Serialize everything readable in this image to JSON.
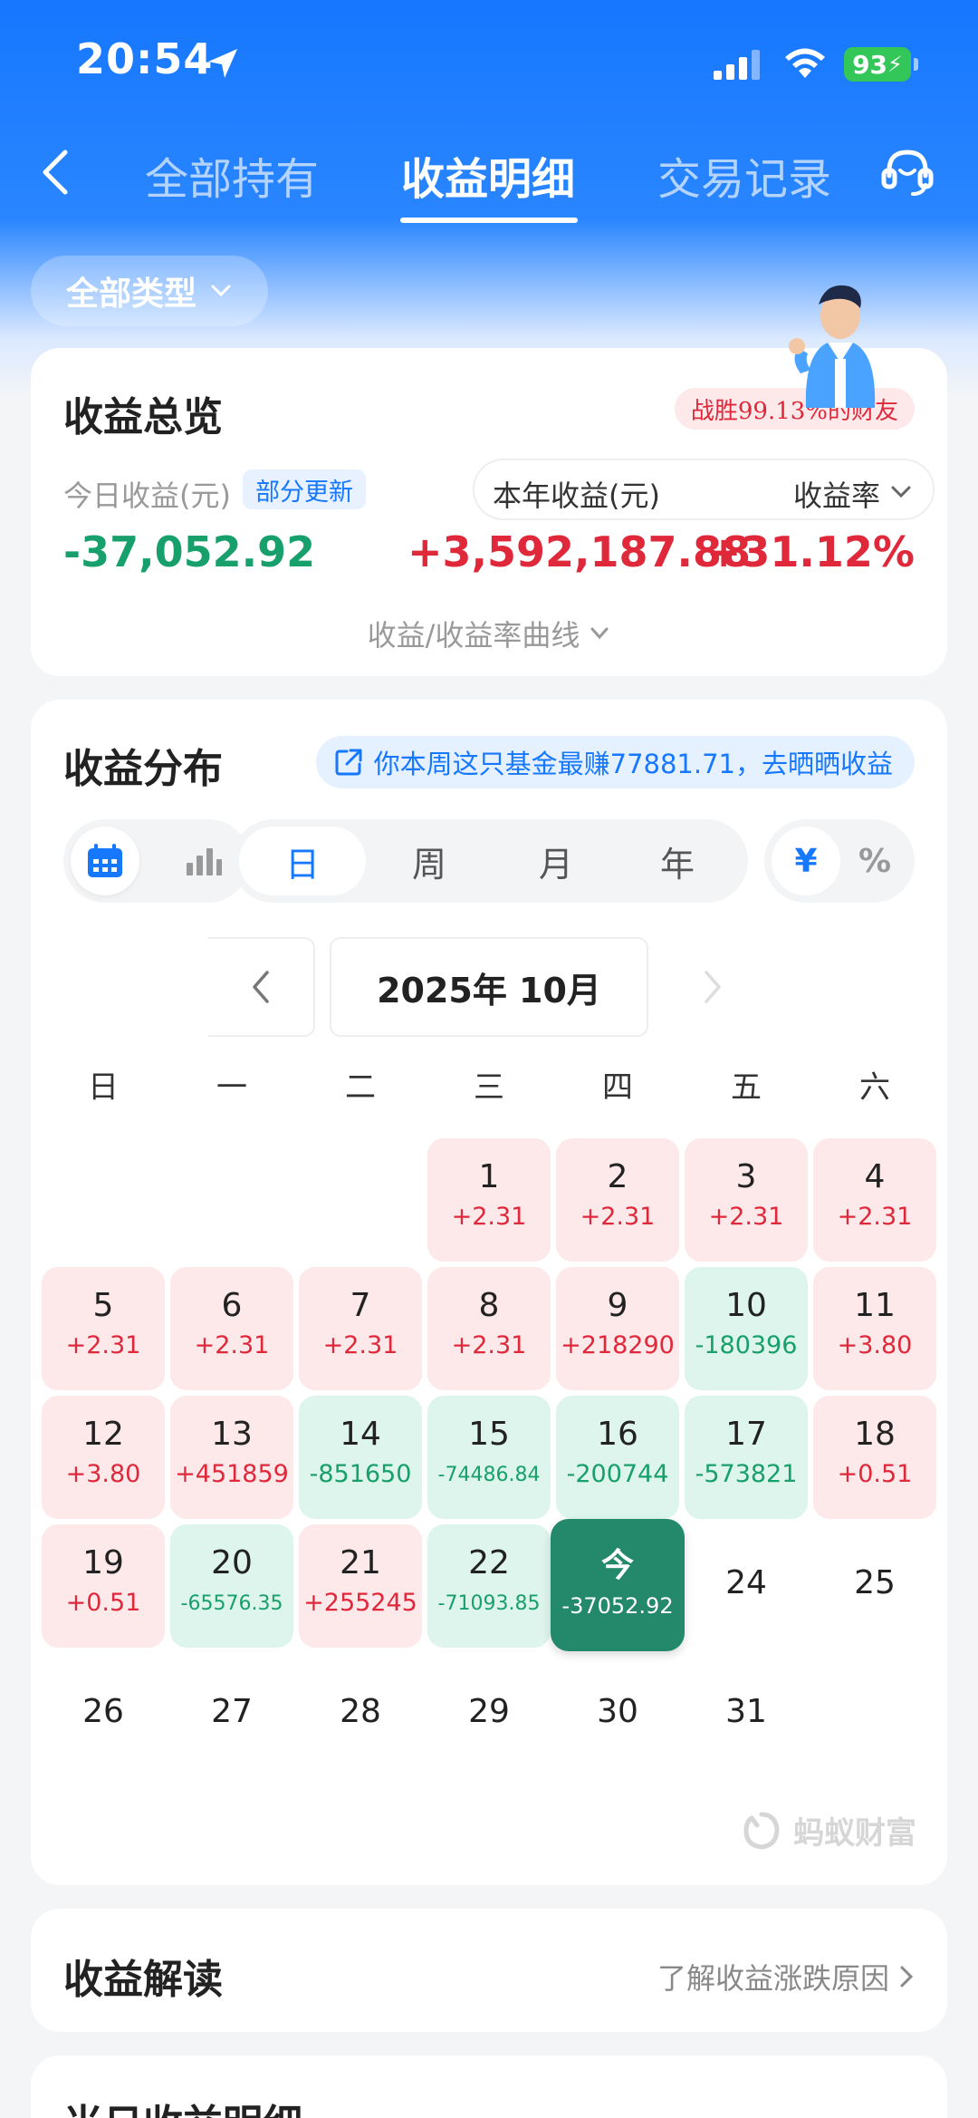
{
  "status_bar": {
    "time": "20:54",
    "battery": "93"
  },
  "nav": {
    "tabs": [
      {
        "label": "全部持有"
      },
      {
        "label": "收益明细"
      },
      {
        "label": "交易记录"
      }
    ]
  },
  "filter": {
    "type_label": "全部类型"
  },
  "overview": {
    "title": "收益总览",
    "beat_text": "战胜99.13%的财友",
    "today_label": "今日收益(元)",
    "partial_update": "部分更新",
    "year_label": "本年收益(元)",
    "rate_label": "收益率",
    "today_value": "-37,052.92",
    "year_value": "+3,592,187.88",
    "rate_value": "+31.12%",
    "curve_toggle": "收益/收益率曲线"
  },
  "distribution": {
    "title": "收益分布",
    "promo": "你本周这只基金最赚77881.71，去晒晒收益",
    "periods": [
      "日",
      "周",
      "月",
      "年"
    ],
    "units": [
      "¥",
      "%"
    ],
    "month": "2025年 10月",
    "weekdays": [
      "日",
      "一",
      "二",
      "三",
      "四",
      "五",
      "六"
    ],
    "days": [
      {
        "n": "1",
        "v": "+2.31"
      },
      {
        "n": "2",
        "v": "+2.31"
      },
      {
        "n": "3",
        "v": "+2.31"
      },
      {
        "n": "4",
        "v": "+2.31"
      },
      {
        "n": "5",
        "v": "+2.31"
      },
      {
        "n": "6",
        "v": "+2.31"
      },
      {
        "n": "7",
        "v": "+2.31"
      },
      {
        "n": "8",
        "v": "+2.31"
      },
      {
        "n": "9",
        "v": "+218290"
      },
      {
        "n": "10",
        "v": "-180396"
      },
      {
        "n": "11",
        "v": "+3.80"
      },
      {
        "n": "12",
        "v": "+3.80"
      },
      {
        "n": "13",
        "v": "+451859"
      },
      {
        "n": "14",
        "v": "-851650"
      },
      {
        "n": "15",
        "v": "-74486.84"
      },
      {
        "n": "16",
        "v": "-200744"
      },
      {
        "n": "17",
        "v": "-573821"
      },
      {
        "n": "18",
        "v": "+0.51"
      },
      {
        "n": "19",
        "v": "+0.51"
      },
      {
        "n": "20",
        "v": "-65576.35"
      },
      {
        "n": "21",
        "v": "+255245"
      },
      {
        "n": "22",
        "v": "-71093.85"
      },
      {
        "n": "今",
        "v": "-37052.92"
      },
      {
        "n": "24",
        "v": ""
      },
      {
        "n": "25",
        "v": ""
      },
      {
        "n": "26",
        "v": ""
      },
      {
        "n": "27",
        "v": ""
      },
      {
        "n": "28",
        "v": ""
      },
      {
        "n": "29",
        "v": ""
      },
      {
        "n": "30",
        "v": ""
      },
      {
        "n": "31",
        "v": ""
      }
    ],
    "watermark": "蚂蚁财富"
  },
  "interpretation": {
    "title": "收益解读",
    "link": "了解收益涨跌原因"
  },
  "detail": {
    "title": "当日收益明细"
  },
  "colors": {
    "brand_blue": "#1677ff",
    "gain_red": "#e0283b",
    "loss_green": "#18a06c",
    "today_green": "#23896a"
  }
}
